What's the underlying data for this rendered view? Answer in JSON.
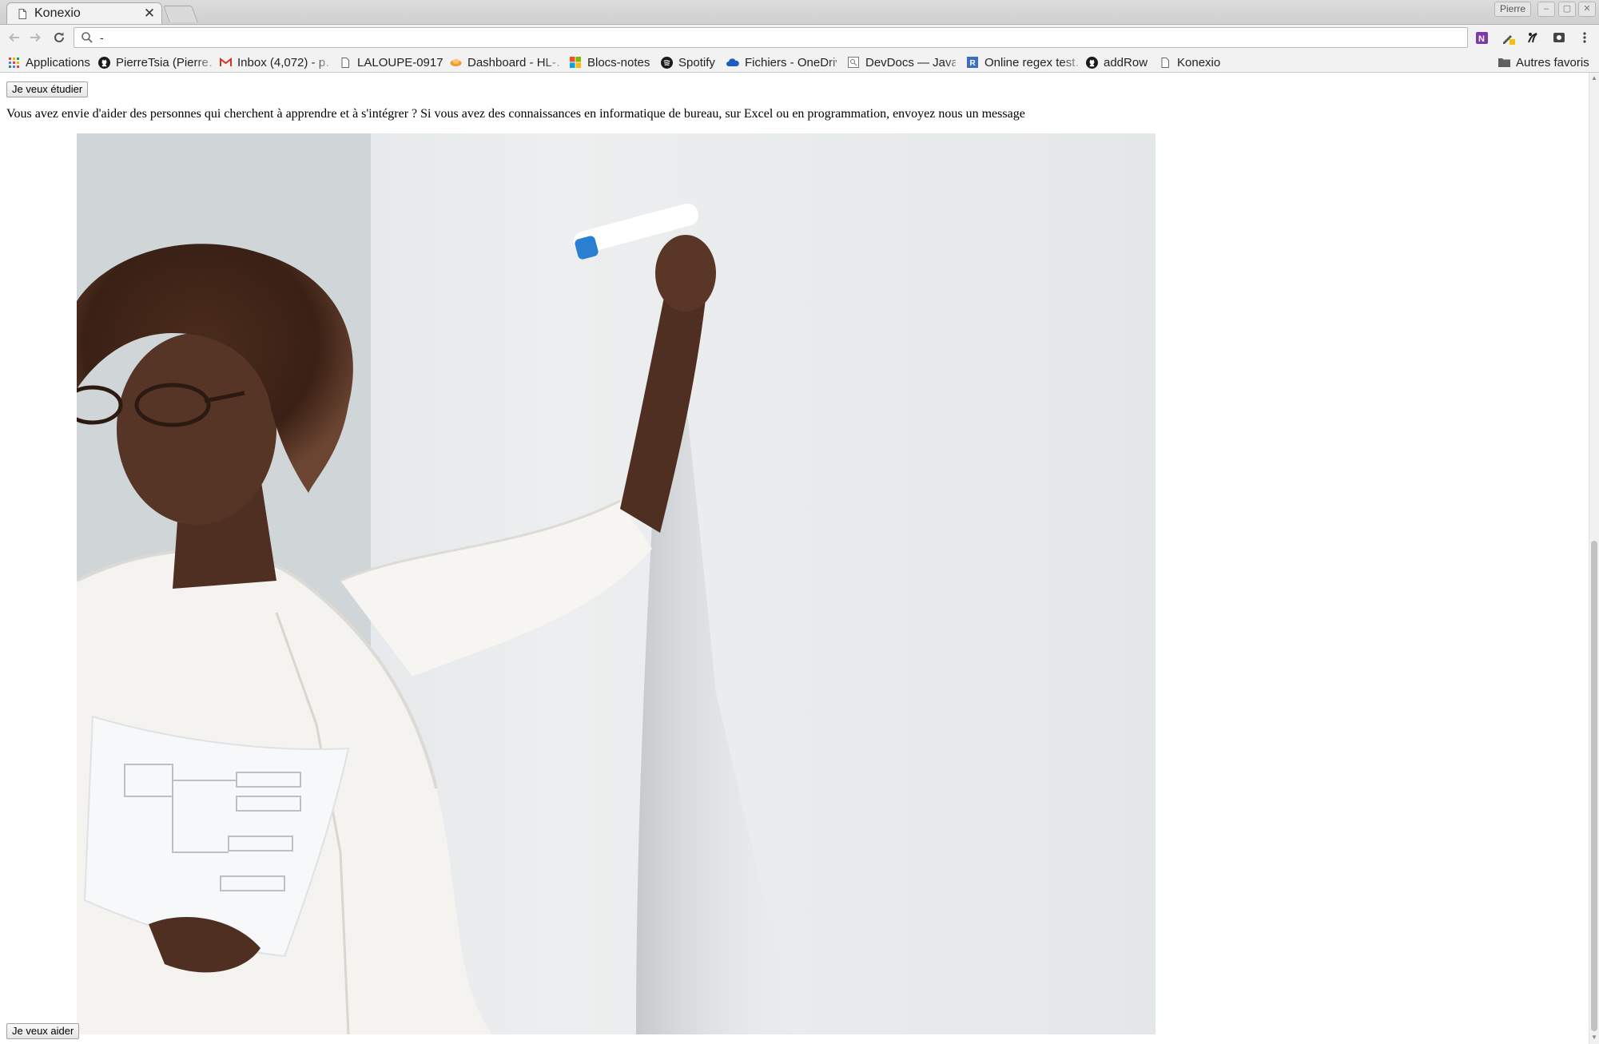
{
  "browser": {
    "tab": {
      "title": "Konexio",
      "close_glyph": "✕"
    },
    "profile_name": "Pierre",
    "window_buttons": [
      "–",
      "▢",
      "✕"
    ],
    "address": {
      "value": "-"
    },
    "bookmarks": [
      {
        "label": "Applications",
        "icon": "apps-grid-icon"
      },
      {
        "label": "PierreTsia (Pierre…",
        "icon": "github-icon"
      },
      {
        "label": "Inbox (4,072) - p…",
        "icon": "gmail-icon"
      },
      {
        "label": "LALOUPE-0917",
        "icon": "page-icon"
      },
      {
        "label": "Dashboard - HL-…",
        "icon": "dashboard-icon"
      },
      {
        "label": "Blocs-notes",
        "icon": "microsoft-icon"
      },
      {
        "label": "Spotify",
        "icon": "spotify-icon"
      },
      {
        "label": "Fichiers - OneDriv…",
        "icon": "onedrive-icon"
      },
      {
        "label": "DevDocs — Java…",
        "icon": "devdocs-icon"
      },
      {
        "label": "Online regex test…",
        "icon": "regex-icon"
      },
      {
        "label": "addRow",
        "icon": "github-icon"
      },
      {
        "label": "Konexio",
        "icon": "page-icon"
      }
    ],
    "other_bookmarks": "Autres favoris"
  },
  "page": {
    "study_button": "Je veux étudier",
    "intro_text": "Vous avez envie d'aider des personnes qui cherchent à apprendre et à s'intégrer ? Si vous avez des connaissances en informatique de bureau, sur Excel ou en programmation, envoyez nous un message",
    "help_button": "Je veux aider",
    "photo_icon": "teacher-at-whiteboard-photo"
  },
  "colors": {
    "accent_red": "#e34132",
    "onenote_purple": "#7b3aa7",
    "onedrive_blue": "#1e5cc2"
  }
}
